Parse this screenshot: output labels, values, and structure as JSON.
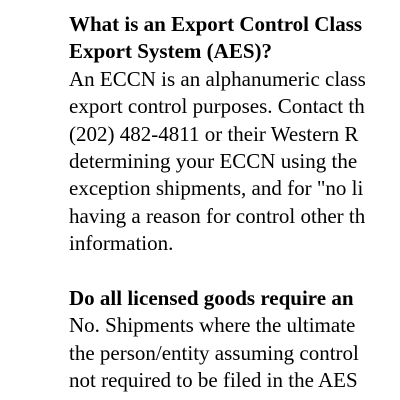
{
  "sections": [
    {
      "heading_lines": [
        "What is an Export Control Class",
        "Export System (AES)?"
      ],
      "body_lines": [
        "An ECCN is an alphanumeric class",
        "export control purposes. Contact th",
        "(202) 482-4811 or their Western R",
        "determining your ECCN using the ",
        "exception shipments, and for \"no li",
        "having a reason for control other th",
        "information."
      ]
    },
    {
      "heading_lines": [
        "Do all licensed goods require an"
      ],
      "body_lines": [
        "No.  Shipments where the ultimate",
        "the person/entity assuming control",
        "not required to be filed in the AES"
      ]
    }
  ]
}
